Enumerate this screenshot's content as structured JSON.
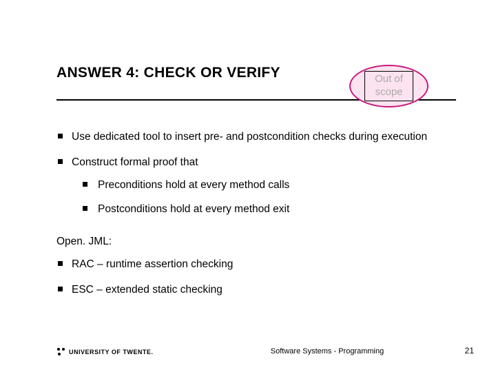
{
  "title": "ANSWER 4: CHECK OR VERIFY",
  "scope_badge": "Out of scope",
  "bullets": [
    {
      "text": "Use dedicated tool to insert pre- and postcondition checks during execution"
    },
    {
      "text": "Construct formal proof that",
      "sub": [
        "Preconditions hold at every method calls",
        "Postconditions hold at every method exit"
      ]
    }
  ],
  "section_label": "Open. JML:",
  "second_bullets": [
    "RAC – runtime assertion checking",
    "ESC – extended static checking"
  ],
  "footer": {
    "university": "UNIVERSITY OF TWENTE.",
    "center": "Software Systems - Programming",
    "page": "21"
  }
}
